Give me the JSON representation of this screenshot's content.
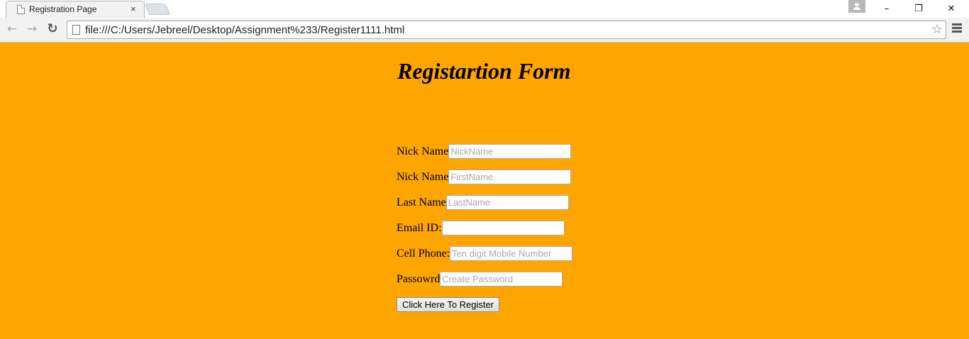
{
  "browser": {
    "tab_title": "Registration Page",
    "tab_close": "×",
    "url": "file:///C:/Users/Jebreel/Desktop/Assignment%233/Register1111.html",
    "icons": [
      "page-icon",
      "close-icon",
      "back-icon",
      "forward-icon",
      "reload-icon",
      "star-icon",
      "menu-icon",
      "profile-icon"
    ],
    "window_controls": {
      "minimize": "–",
      "restore": "❐",
      "close": "✕"
    }
  },
  "page": {
    "background": "#ffa500",
    "title": "Registartion Form",
    "fields": [
      {
        "label": "Nick Name",
        "placeholder": "NickName",
        "value": ""
      },
      {
        "label": "Nick Name",
        "placeholder": "FirstName",
        "value": ""
      },
      {
        "label": "Last Name",
        "placeholder": "LastName",
        "value": ""
      },
      {
        "label": "Email ID:",
        "placeholder": "",
        "value": ""
      },
      {
        "label": "Cell Phone:",
        "placeholder": "Ten digit Mobile Number",
        "value": ""
      },
      {
        "label": "Passowrd",
        "placeholder": "Create Password",
        "value": ""
      }
    ],
    "submit_label": "Click Here To Register"
  }
}
